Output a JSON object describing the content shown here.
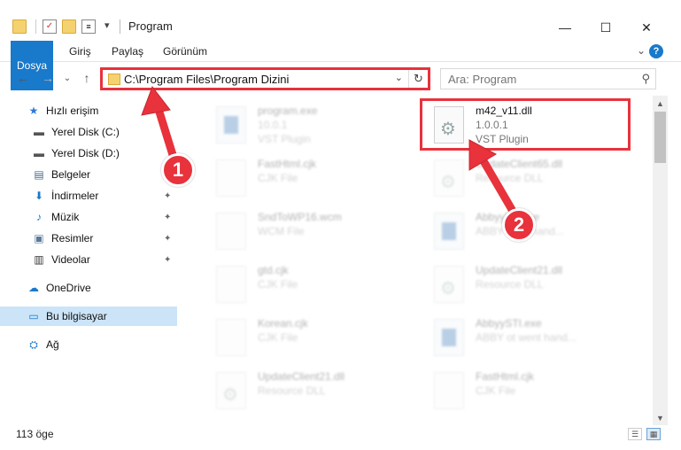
{
  "window": {
    "title": "Program",
    "quick_access_dropdown": "▾",
    "minimize": "—",
    "maximize": "☐",
    "close": "✕"
  },
  "ribbon": {
    "tabs": [
      "Dosya",
      "Giriş",
      "Paylaş",
      "Görünüm"
    ],
    "expand": "⌄",
    "help": "?"
  },
  "nav": {
    "back": "←",
    "forward": "→",
    "recent": "⌄",
    "up": "↑"
  },
  "address": {
    "path": "C:\\Program Files\\Program Dizini",
    "dropdown": "⌄",
    "refresh": "↻"
  },
  "search": {
    "placeholder": "Ara: Program",
    "icon": "⚲"
  },
  "sidebar": {
    "items": [
      {
        "label": "Hızlı erişim",
        "icon": "star-icon",
        "glyph": "★",
        "color": "#2d7bd8",
        "pinned": false
      },
      {
        "label": "Yerel Disk (C:)",
        "icon": "drive-icon",
        "glyph": "▬",
        "color": "#555555",
        "pinned": false
      },
      {
        "label": "Yerel Disk (D:)",
        "icon": "drive-icon",
        "glyph": "▬",
        "color": "#555555",
        "pinned": false
      },
      {
        "label": "Belgeler",
        "icon": "documents-icon",
        "glyph": "▤",
        "color": "#4a6b8a",
        "pinned": true
      },
      {
        "label": "İndirmeler",
        "icon": "downloads-icon",
        "glyph": "⬇",
        "color": "#1979ca",
        "pinned": true
      },
      {
        "label": "Müzik",
        "icon": "music-icon",
        "glyph": "♪",
        "color": "#1979ca",
        "pinned": true
      },
      {
        "label": "Resimler",
        "icon": "pictures-icon",
        "glyph": "▣",
        "color": "#5a7a9a",
        "pinned": true
      },
      {
        "label": "Videolar",
        "icon": "videos-icon",
        "glyph": "▥",
        "color": "#333333",
        "pinned": true
      },
      {
        "label": "OneDrive",
        "icon": "cloud-icon",
        "glyph": "☁",
        "color": "#1979ca",
        "pinned": false
      },
      {
        "label": "Bu bilgisayar",
        "icon": "computer-icon",
        "glyph": "▭",
        "color": "#1979ca",
        "pinned": false,
        "selected": true
      },
      {
        "label": "Ağ",
        "icon": "network-icon",
        "glyph": "⛭",
        "color": "#1979ca",
        "pinned": false
      }
    ],
    "pin_glyph": "📌"
  },
  "files": [
    {
      "name": "program.exe",
      "line2": "10.0.1",
      "line3": "VST Plugin",
      "kind": "exe",
      "blurred": true
    },
    {
      "name": "m42_v11.dll",
      "line2": "1.0.0.1",
      "line3": "VST Plugin",
      "kind": "dll",
      "blurred": false,
      "highlighted": true
    },
    {
      "name": "FastHtml.cjk",
      "line2": "CJK File",
      "line3": "",
      "kind": "blank",
      "blurred": true
    },
    {
      "name": "UpdateClient65.dll",
      "line2": "Resource DLL",
      "line3": "",
      "kind": "dll",
      "blurred": true
    },
    {
      "name": "SndToWP16.wcm",
      "line2": "WCM File",
      "line3": "",
      "kind": "blank",
      "blurred": true
    },
    {
      "name": "AbbyyFR.exe",
      "line2": "ABBYY ocr hand...",
      "line3": "",
      "kind": "exe",
      "blurred": true
    },
    {
      "name": "gtd.cjk",
      "line2": "CJK File",
      "line3": "",
      "kind": "blank",
      "blurred": true
    },
    {
      "name": "UpdateClient21.dll",
      "line2": "Resource DLL",
      "line3": "",
      "kind": "dll",
      "blurred": true
    },
    {
      "name": "Korean.cjk",
      "line2": "CJK File",
      "line3": "",
      "kind": "blank",
      "blurred": true
    },
    {
      "name": "AbbyySTI.exe",
      "line2": "ABBY ot went hand...",
      "line3": "",
      "kind": "exe",
      "blurred": true
    },
    {
      "name": "UpdateClient21.dll",
      "line2": "Resource DLL",
      "line3": "",
      "kind": "dll",
      "blurred": true
    },
    {
      "name": "FastHtml.cjk",
      "line2": "CJK File",
      "line3": "",
      "kind": "blank",
      "blurred": true
    }
  ],
  "markers": [
    "1",
    "2"
  ],
  "status": {
    "count": "113 öge",
    "details_view": "☰",
    "icons_view": "▦"
  }
}
